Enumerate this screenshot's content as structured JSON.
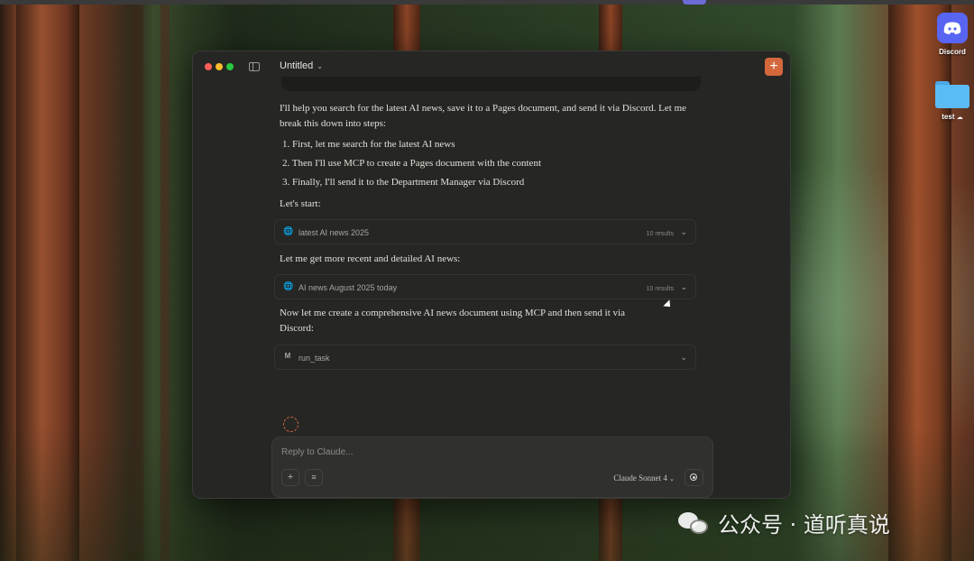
{
  "desktop": {
    "icons": [
      {
        "label": "Discord",
        "icon": "discord-icon"
      },
      {
        "label": "test",
        "icon": "folder-icon",
        "badge": "cloud-icon"
      }
    ]
  },
  "window": {
    "title": "Untitled",
    "new_chat_icon": "plus-icon",
    "accent": "#d4683c"
  },
  "conversation": {
    "intro": "I'll help you search for the latest AI news, save it to a Pages document, and send it via Discord. Let me break this down into steps:",
    "steps": [
      "1. First, let me search for the latest AI news",
      "2. Then I'll use MCP to create a Pages document with the content",
      "3. Finally, I'll send it to the Department Manager via Discord"
    ],
    "lets_start": "Let's start:",
    "tool1": {
      "label": "latest AI news 2025",
      "count": "10 results",
      "icon": "globe-icon"
    },
    "more_text": "Let me get more recent and detailed AI news:",
    "tool2": {
      "label": "AI news August 2025 today",
      "count": "10 results",
      "icon": "globe-icon"
    },
    "create_text": "Now let me create a comprehensive AI news document using MCP and then send it via Discord:",
    "tool3": {
      "label": "run_task",
      "icon_letter": "M"
    }
  },
  "composer": {
    "placeholder": "Reply to Claude...",
    "add_icon": "plus-icon",
    "tools_icon": "sliders-icon",
    "model": "Claude Sonnet 4",
    "voice_icon": "voice-icon"
  },
  "watermark": {
    "text": "公众号 · 道听真说",
    "logo": "wechat-icon"
  }
}
